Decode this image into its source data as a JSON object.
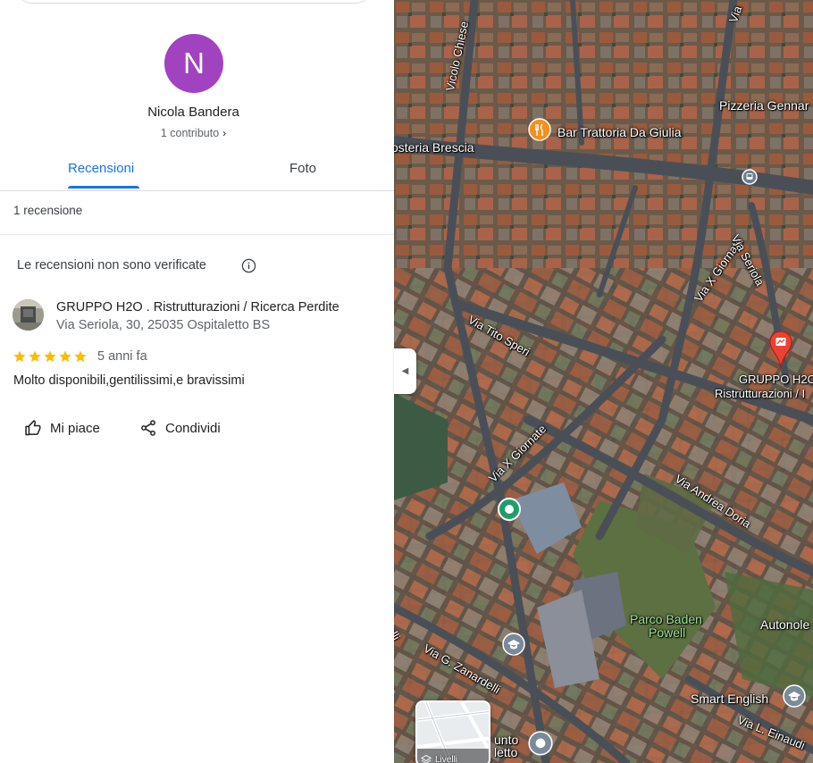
{
  "profile": {
    "initial": "N",
    "name": "Nicola Bandera",
    "contributions": "1 contributo"
  },
  "tabs": [
    {
      "label": "Recensioni",
      "active": true
    },
    {
      "label": "Foto",
      "active": false
    }
  ],
  "reviews_count": "1 recensione",
  "notice": "Le recensioni non sono verificate",
  "review": {
    "place_name": "GRUPPO H2O . Ristrutturazioni / Ricerca Perdite",
    "place_address": "Via Seriola, 30, 25035 Ospitaletto BS",
    "rating": 5,
    "date": "5 anni fa",
    "text": "Molto disponibili,gentilissimi,e bravissimi"
  },
  "actions": {
    "like": "Mi piace",
    "share": "Condividi"
  },
  "map": {
    "labels": {
      "vicolo_chiese": "Vicolo Chiese",
      "bar_trattoria": "Bar Trattoria Da Giulia",
      "osteria": "osteria Brescia",
      "pizzeria": "Pizzeria Gennar",
      "via_x_giornate_1": "Via X Giornate",
      "via_seriola": "Via Seriola",
      "via_tito_speri": "Via Tito Speri",
      "gruppo_line1": "GRUPPO H2O",
      "gruppo_line2": "Ristrutturazioni / I",
      "via_x_giornate_2": "Via X Giornate",
      "via_andrea_doria": "Via Andrea Doria",
      "parco_1": "Parco Baden",
      "parco_2": "Powell",
      "autonole": "Autonole",
      "via_zanardelli": "Via G. Zanardelli",
      "smart_english": "Smart English",
      "via_einaudi": "Via L. Einaudi",
      "punto_1": "unto",
      "punto_2": "letto",
      "via_left": "elli",
      "via_top": "Via"
    },
    "layers_label": "Livelli",
    "colors": {
      "restaurant_pin": "#f29020",
      "place_pin": "#ea4335",
      "park_pin": "#1e9e6a",
      "school_pin": "#7b8a99"
    }
  }
}
